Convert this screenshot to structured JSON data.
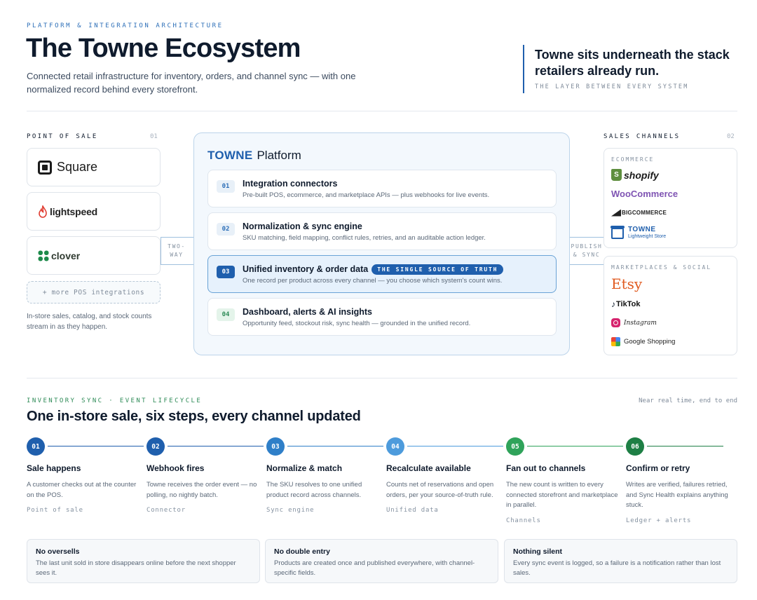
{
  "header": {
    "eyebrow": "PLATFORM & INTEGRATION ARCHITECTURE",
    "title": "The Towne Ecosystem",
    "subtitle": "Connected retail infrastructure for inventory, orders, and channel sync — with one normalized record behind every storefront.",
    "callout": "Towne sits underneath the stack retailers already run.",
    "callout_sub": "THE LAYER BETWEEN EVERY SYSTEM"
  },
  "pos": {
    "label": "POINT OF SALE",
    "num": "01",
    "vendors": [
      {
        "name": "Square",
        "icon": "square-logo-icon"
      },
      {
        "name": "lightspeed",
        "icon": "lightspeed-flame-icon",
        "color": "#e03c31"
      },
      {
        "name": "clover",
        "icon": "clover-leaf-icon",
        "color": "#1d8a4a"
      }
    ],
    "more": "+ more POS integrations",
    "note": "In-store sales, catalog, and stock counts stream in as they happen."
  },
  "connectors": {
    "left": "TWO-WAY",
    "left_lines": [
      "TWO-",
      "WAY"
    ],
    "right_lines": [
      "PUBLISH",
      "& SYNC"
    ]
  },
  "platform": {
    "brand": "TOWNE",
    "name": "Platform",
    "layers": [
      {
        "num": "01",
        "title": "Integration connectors",
        "desc": "Pre-built POS, ecommerce, and marketplace APIs — plus webhooks for live events."
      },
      {
        "num": "02",
        "title": "Normalization & sync engine",
        "desc": "SKU matching, field mapping, conflict rules, retries, and an auditable action ledger."
      },
      {
        "num": "03",
        "title": "Unified inventory & order data",
        "badge": "THE SINGLE SOURCE OF TRUTH",
        "desc": "One record per product across every channel — you choose which system's count wins."
      },
      {
        "num": "04",
        "title": "Dashboard, alerts & AI insights",
        "desc": "Opportunity feed, stockout risk, sync health — grounded in the unified record."
      }
    ]
  },
  "channels": {
    "label": "SALES CHANNELS",
    "num": "02",
    "ecommerce": {
      "label": "ECOMMERCE",
      "items": [
        "shopify",
        "WooCommerce",
        "BIGCOMMERCE",
        "TOWNE",
        "Lightweight Store"
      ]
    },
    "marketplaces": {
      "label": "MARKETPLACES & SOCIAL",
      "items": [
        "Etsy",
        "TikTok",
        "Instagram",
        "Google Shopping"
      ]
    }
  },
  "lifecycle": {
    "label": "INVENTORY SYNC · EVENT LIFECYCLE",
    "right": "Near real time, end to end",
    "title": "One in-store sale, six steps, every channel updated",
    "steps": [
      {
        "num": "01",
        "title": "Sale happens",
        "desc": "A customer checks out at the counter on the POS.",
        "tag": "Point of sale",
        "color": "#1f5fad"
      },
      {
        "num": "02",
        "title": "Webhook fires",
        "desc": "Towne receives the order event — no polling, no nightly batch.",
        "tag": "Connector",
        "color": "#1f5fad"
      },
      {
        "num": "03",
        "title": "Normalize & match",
        "desc": "The SKU resolves to one unified product record across channels.",
        "tag": "Sync engine",
        "color": "#2f7fc8"
      },
      {
        "num": "04",
        "title": "Recalculate available",
        "desc": "Counts net of reservations and open orders, per your source-of-truth rule.",
        "tag": "Unified data",
        "color": "#4d9bdc"
      },
      {
        "num": "05",
        "title": "Fan out to channels",
        "desc": "The new count is written to every connected storefront and marketplace in parallel.",
        "tag": "Channels",
        "color": "#2fa35a"
      },
      {
        "num": "06",
        "title": "Confirm or retry",
        "desc": "Writes are verified, failures retried, and Sync Health explains anything stuck.",
        "tag": "Ledger + alerts",
        "color": "#1e7f45"
      }
    ]
  },
  "benefits": [
    {
      "title": "No oversells",
      "desc": "The last unit sold in store disappears online before the next shopper sees it."
    },
    {
      "title": "No double entry",
      "desc": "Products are created once and published everywhere, with channel-specific fields."
    },
    {
      "title": "Nothing silent",
      "desc": "Every sync event is logged, so a failure is a notification rather than lost sales."
    }
  ]
}
